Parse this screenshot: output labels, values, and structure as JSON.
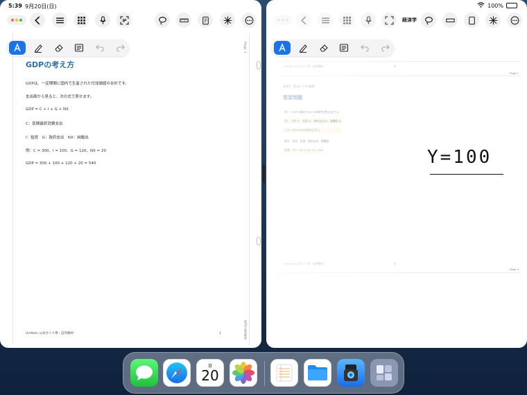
{
  "status_bar": {
    "time": "5:39",
    "date": "9月20日(日)",
    "battery": "100%"
  },
  "colors": {
    "accent": "#1a74e8",
    "title_blue": "#2a6fa8",
    "wallpaper": "#1d3656"
  },
  "left_window": {
    "page_label": "Page 1",
    "title": "GDPの考え方",
    "lines": [
      "GDPは、一定期間に国内で生産された付加価値の合計です。",
      "支出面から見ると、次の式で表せます。",
      "GDP = C + I + G + NX",
      "C：民間最終消費支出",
      "I：投資　G：政府支出　NX：純輸出",
      "例：C = 300、I = 100、G = 120、NX = 20",
      "GDP = 300 + 100 + 120 + 20 = 540"
    ],
    "footer_left": "UniNote 公式ガイド用・自作教材",
    "footer_num": "1",
    "side_text": "第3回 経済教室"
  },
  "right_window": {
    "title": "経済学",
    "page1_header": "UniNote 公式ガイド用・自作教材",
    "page1_num": "2",
    "page1_label": "Page 1",
    "section_label": "経済学｜第4回 マクロ経済",
    "heading": "復習問題",
    "lines": [
      "問1：GDPを構成する4つの項目を答えなさい。",
      "問2：消費75、投資15、政府支出20、純輸出-5。",
      "このときのGDPを求めなさい。",
      "解答：消費、投資、政府支出、純輸出",
      "計算：75 + 15 + 20 - 5 = 105"
    ],
    "handwriting": "Y=100",
    "page2_footer": "UniNote 公式ガイド用・自作教材",
    "page2_num": "3",
    "page2_label": "Page 4"
  },
  "toolbar_icons": [
    "back-chevron-icon",
    "list-icon",
    "grid-icon",
    "microphone-icon",
    "scan-icon",
    "lasso-icon",
    "ruler-icon",
    "clipboard-icon",
    "laser-icon",
    "more-icon"
  ],
  "pen_tools": [
    "pen",
    "pencil",
    "eraser",
    "text",
    "undo",
    "redo"
  ],
  "dock": {
    "calendar_day_of_week": "日",
    "calendar_date": "20",
    "apps": [
      "Messages",
      "Safari",
      "Calendar",
      "Photos",
      "Notes",
      "Files",
      "Preview",
      "App Library"
    ]
  }
}
